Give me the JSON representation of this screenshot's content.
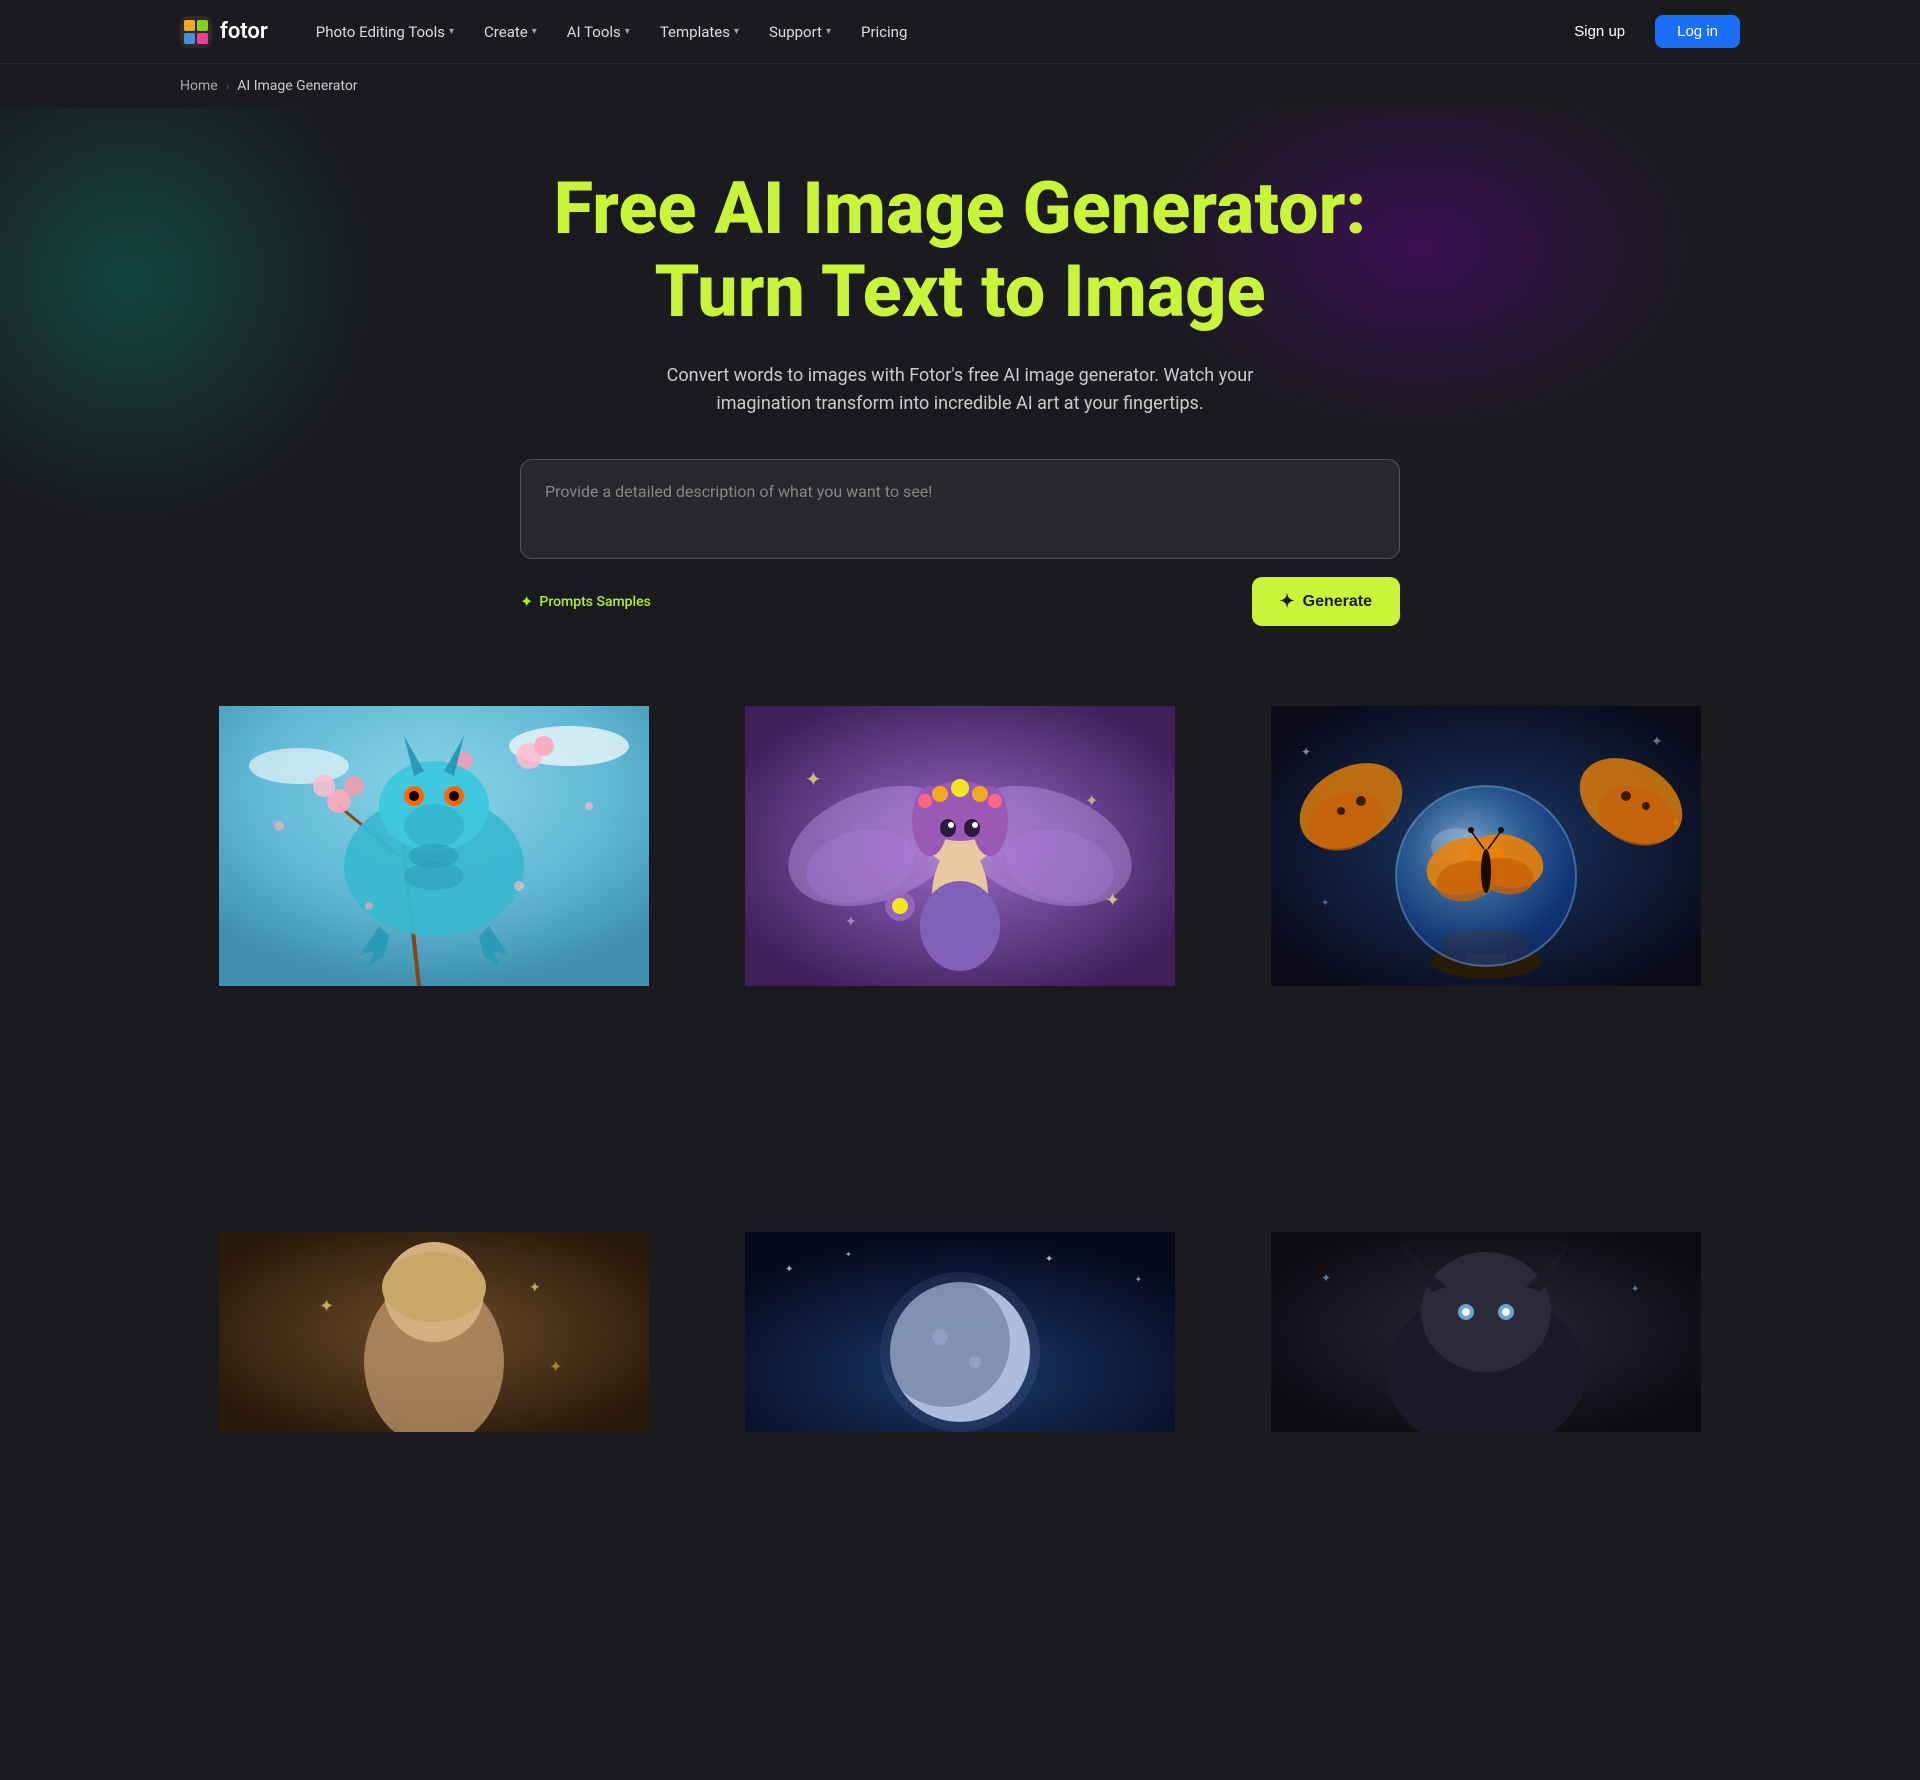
{
  "nav": {
    "logo_text": "fotor",
    "menu_items": [
      {
        "label": "Photo Editing Tools",
        "has_chevron": true
      },
      {
        "label": "Create",
        "has_chevron": true
      },
      {
        "label": "AI Tools",
        "has_chevron": true
      },
      {
        "label": "Templates",
        "has_chevron": true
      },
      {
        "label": "Support",
        "has_chevron": true
      },
      {
        "label": "Pricing",
        "has_chevron": false
      }
    ],
    "signup_label": "Sign up",
    "login_label": "Log in"
  },
  "breadcrumb": {
    "home": "Home",
    "separator": "›",
    "current": "AI Image Generator"
  },
  "hero": {
    "title_line1": "Free AI Image Generator:",
    "title_line2": "Turn Text to Image",
    "subtitle": "Convert words to images with Fotor's free AI image generator. Watch your imagination transform into incredible AI art at your fingertips.",
    "prompt_placeholder": "Provide a detailed description of what you want to see!",
    "prompts_samples_label": "Prompts Samples",
    "generate_label": "Generate"
  },
  "gallery": {
    "items": [
      {
        "id": "dragon",
        "alt": "Dragon with cherry blossoms",
        "row": 1
      },
      {
        "id": "fairy",
        "alt": "Purple fairy with flowers",
        "row": 1
      },
      {
        "id": "butterfly",
        "alt": "Butterfly crystal ball",
        "row": 1
      },
      {
        "id": "bottom-left",
        "alt": "Mystical figure",
        "row": 2
      },
      {
        "id": "bottom-center",
        "alt": "Moon scene",
        "row": 2
      },
      {
        "id": "bottom-right",
        "alt": "Dark creature",
        "row": 2
      }
    ]
  },
  "colors": {
    "accent_green": "#c8f53a",
    "nav_bg": "#1a1a1f",
    "hero_bg": "#1a1a1f",
    "btn_login_bg": "#1a6ef5"
  }
}
